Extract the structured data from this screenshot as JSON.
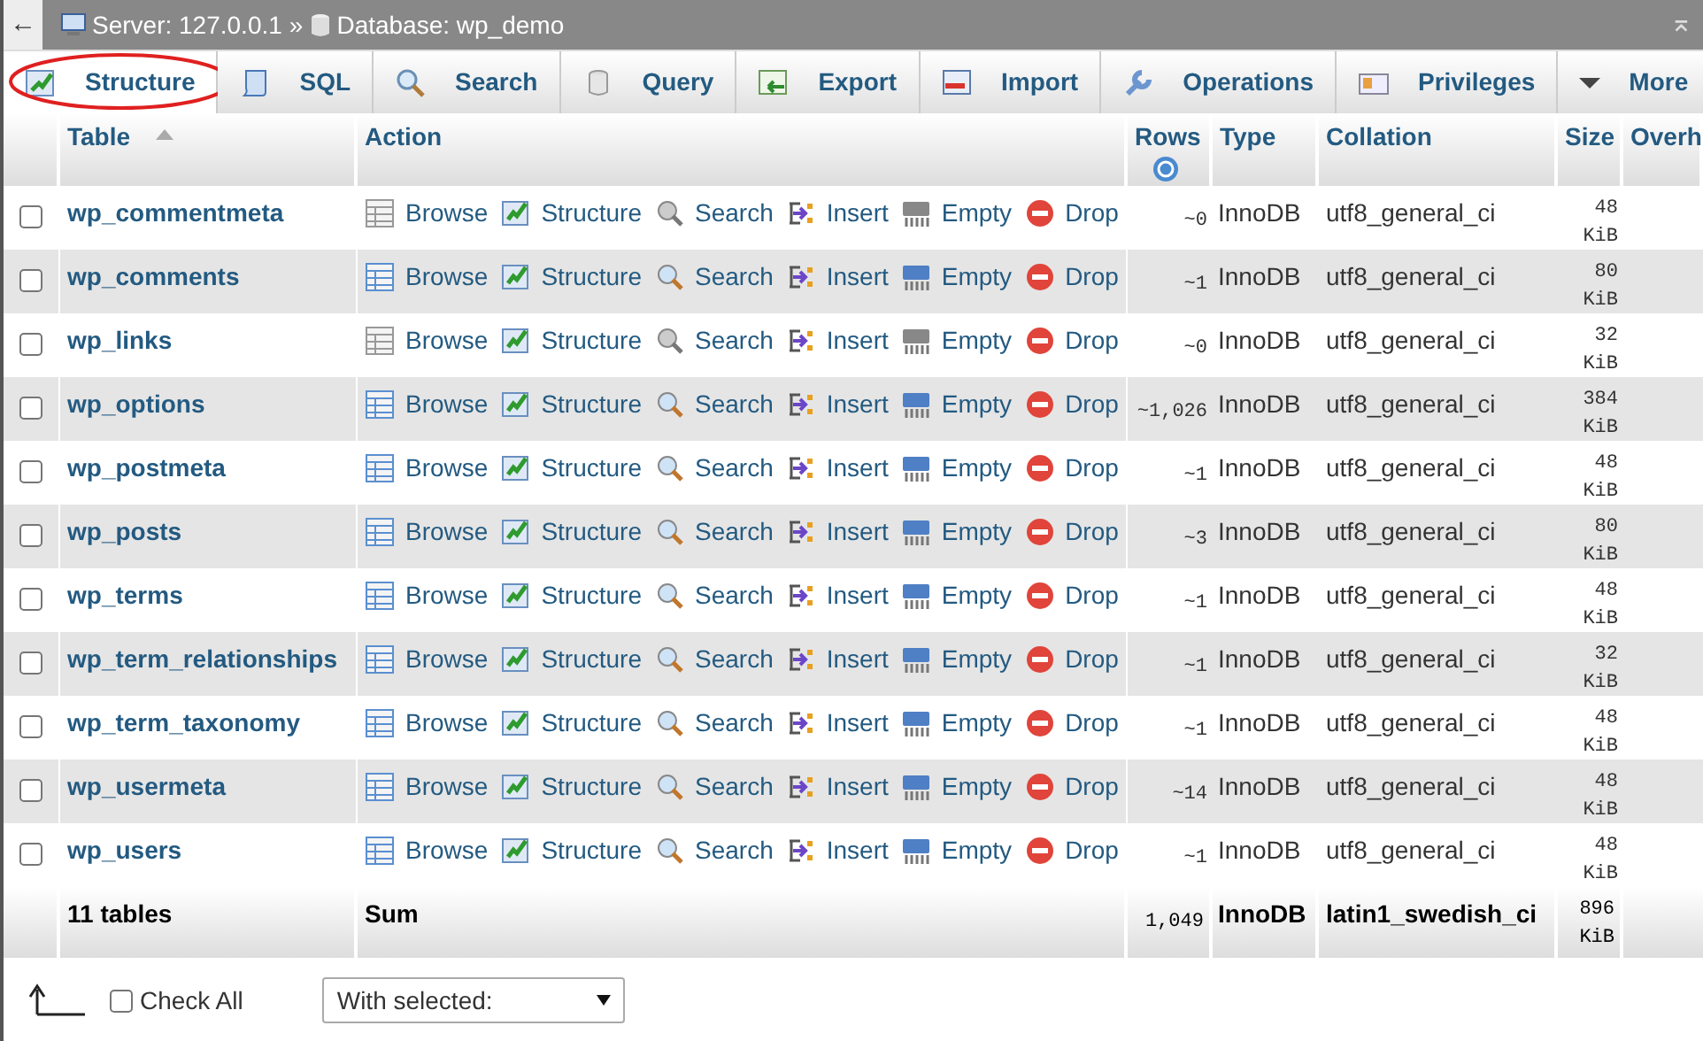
{
  "breadcrumb": {
    "back": "←",
    "server": "Server: 127.0.0.1",
    "separator": "»",
    "database": "Database: wp_demo",
    "collapse": "⌅"
  },
  "tabs": [
    {
      "label": "Structure",
      "selected": true,
      "circled": true
    },
    {
      "label": "SQL",
      "selected": false,
      "circled": false
    },
    {
      "label": "Search",
      "selected": false,
      "circled": false
    },
    {
      "label": "Query",
      "selected": false,
      "circled": false
    },
    {
      "label": "Export",
      "selected": false,
      "circled": false
    },
    {
      "label": "Import",
      "selected": false,
      "circled": false
    },
    {
      "label": "Operations",
      "selected": false,
      "circled": false
    },
    {
      "label": "Privileges",
      "selected": false,
      "circled": false
    },
    {
      "label": "More",
      "selected": false,
      "circled": false
    }
  ],
  "table": {
    "columns": [
      {
        "label": "Table",
        "sorted": true
      },
      {
        "label": "Action",
        "sorted": false
      },
      {
        "label": "Rows",
        "sorted": false
      },
      {
        "label": "Type",
        "sorted": false
      },
      {
        "label": "Collation",
        "sorted": false
      },
      {
        "label": "Size",
        "sorted": false
      },
      {
        "label": "Overh",
        "sorted": false
      }
    ],
    "rows": [
      {
        "name": "wp_commentmeta",
        "checked": false,
        "empty": true,
        "actions": [
          "Browse",
          "Structure",
          "Search",
          "Insert",
          "Empty",
          "Drop"
        ],
        "rows": "~0",
        "type": "InnoDB",
        "collation": "utf8_general_ci",
        "size": "48 KiB"
      },
      {
        "name": "wp_comments",
        "checked": false,
        "empty": false,
        "actions": [
          "Browse",
          "Structure",
          "Search",
          "Insert",
          "Empty",
          "Drop"
        ],
        "rows": "~1",
        "type": "InnoDB",
        "collation": "utf8_general_ci",
        "size": "80 KiB"
      },
      {
        "name": "wp_links",
        "checked": false,
        "empty": true,
        "actions": [
          "Browse",
          "Structure",
          "Search",
          "Insert",
          "Empty",
          "Drop"
        ],
        "rows": "~0",
        "type": "InnoDB",
        "collation": "utf8_general_ci",
        "size": "32 KiB"
      },
      {
        "name": "wp_options",
        "checked": false,
        "empty": false,
        "actions": [
          "Browse",
          "Structure",
          "Search",
          "Insert",
          "Empty",
          "Drop"
        ],
        "rows": "~1,026",
        "type": "InnoDB",
        "collation": "utf8_general_ci",
        "size": "384 KiB"
      },
      {
        "name": "wp_postmeta",
        "checked": false,
        "empty": false,
        "actions": [
          "Browse",
          "Structure",
          "Search",
          "Insert",
          "Empty",
          "Drop"
        ],
        "rows": "~1",
        "type": "InnoDB",
        "collation": "utf8_general_ci",
        "size": "48 KiB"
      },
      {
        "name": "wp_posts",
        "checked": false,
        "empty": false,
        "actions": [
          "Browse",
          "Structure",
          "Search",
          "Insert",
          "Empty",
          "Drop"
        ],
        "rows": "~3",
        "type": "InnoDB",
        "collation": "utf8_general_ci",
        "size": "80 KiB"
      },
      {
        "name": "wp_terms",
        "checked": false,
        "empty": false,
        "actions": [
          "Browse",
          "Structure",
          "Search",
          "Insert",
          "Empty",
          "Drop"
        ],
        "rows": "~1",
        "type": "InnoDB",
        "collation": "utf8_general_ci",
        "size": "48 KiB"
      },
      {
        "name": "wp_term_relationships",
        "checked": false,
        "empty": false,
        "actions": [
          "Browse",
          "Structure",
          "Search",
          "Insert",
          "Empty",
          "Drop"
        ],
        "rows": "~1",
        "type": "InnoDB",
        "collation": "utf8_general_ci",
        "size": "32 KiB"
      },
      {
        "name": "wp_term_taxonomy",
        "checked": false,
        "empty": false,
        "actions": [
          "Browse",
          "Structure",
          "Search",
          "Insert",
          "Empty",
          "Drop"
        ],
        "rows": "~1",
        "type": "InnoDB",
        "collation": "utf8_general_ci",
        "size": "48 KiB"
      },
      {
        "name": "wp_usermeta",
        "checked": false,
        "empty": false,
        "actions": [
          "Browse",
          "Structure",
          "Search",
          "Insert",
          "Empty",
          "Drop"
        ],
        "rows": "~14",
        "type": "InnoDB",
        "collation": "utf8_general_ci",
        "size": "48 KiB"
      },
      {
        "name": "wp_users",
        "checked": false,
        "empty": false,
        "actions": [
          "Browse",
          "Structure",
          "Search",
          "Insert",
          "Empty",
          "Drop"
        ],
        "rows": "~1",
        "type": "InnoDB",
        "collation": "utf8_general_ci",
        "size": "48 KiB"
      }
    ],
    "summary": {
      "tables": "11 tables",
      "label": "Sum",
      "rows": "1,049",
      "type": "InnoDB",
      "collation": "latin1_swedish_ci",
      "size": "896 KiB"
    }
  },
  "footer": {
    "check_all": {
      "label": "Check All",
      "checked": false
    },
    "with_selected": {
      "value": "With selected:"
    }
  }
}
